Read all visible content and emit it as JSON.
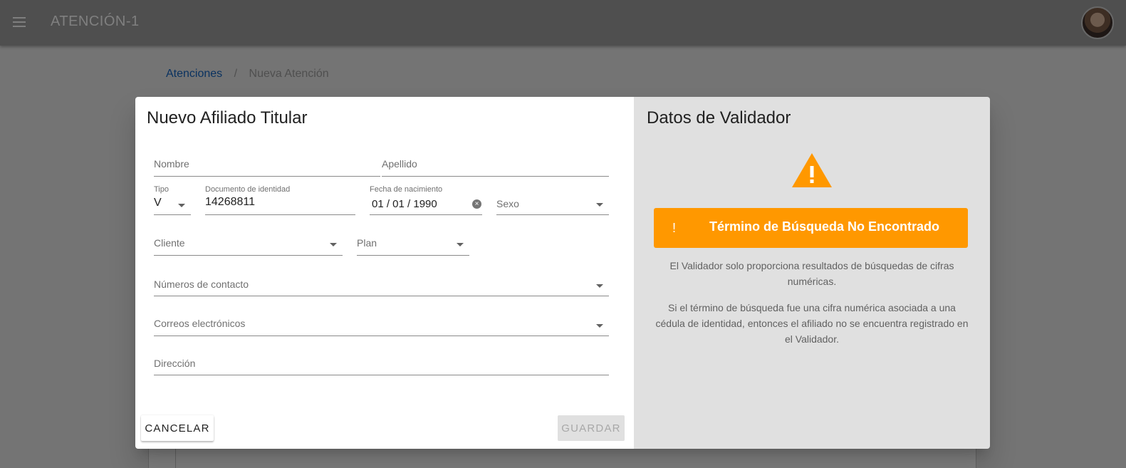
{
  "appbar": {
    "title": "ATENCIÓN-1",
    "menu_icon": "menu-icon",
    "avatar": "avatar"
  },
  "breadcrumb": {
    "link": "Atenciones",
    "separator": "/",
    "current": "Nueva Atención"
  },
  "dialog": {
    "title": "Nuevo Afiliado Titular",
    "fields": {
      "nombre": {
        "label": "Nombre",
        "value": ""
      },
      "apellido": {
        "label": "Apellido",
        "value": ""
      },
      "tipo": {
        "label": "Tipo",
        "value": "V"
      },
      "documento": {
        "label": "Documento de identidad",
        "value": "14268811"
      },
      "fecha": {
        "label": "Fecha de nacimiento",
        "value": "01 / 01 / 1990"
      },
      "sexo": {
        "label": "Sexo",
        "value": ""
      },
      "cliente": {
        "label": "Cliente",
        "value": ""
      },
      "plan": {
        "label": "Plan",
        "value": ""
      },
      "contacto": {
        "label": "Números de contacto",
        "value": ""
      },
      "correos": {
        "label": "Correos electrónicos",
        "value": ""
      },
      "direccion": {
        "label": "Dirección",
        "value": ""
      }
    },
    "buttons": {
      "cancel": "CANCELAR",
      "save": "GUARDAR"
    }
  },
  "validator": {
    "title": "Datos de Validador",
    "alert_icon": "!",
    "alert_text": "Término de Búsqueda No Encontrado",
    "p1": "El Validador solo proporciona resultados de búsquedas de cifras numéricas.",
    "p2": "Si el término de búsqueda fue una cifra numérica asociada a una cédula de identidad, entonces el afiliado no se encuentra registrado en el Validador."
  },
  "colors": {
    "accent": "#1565c0",
    "warning": "#ff9800",
    "panel": "#e0e0e0"
  }
}
